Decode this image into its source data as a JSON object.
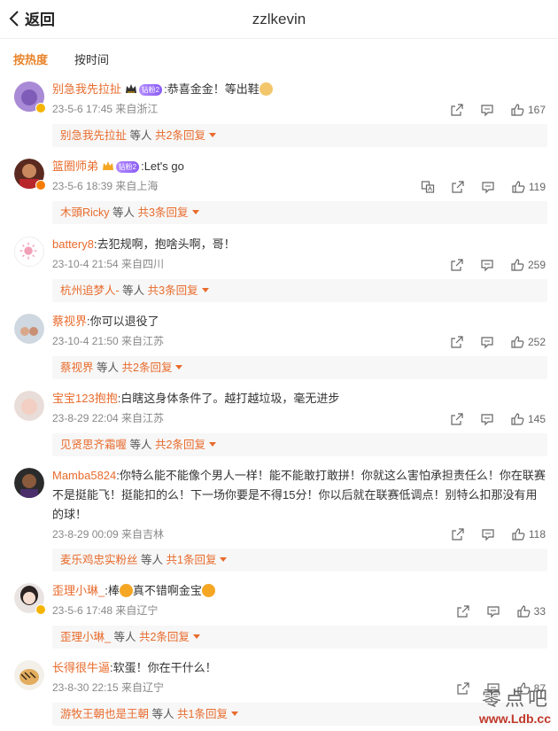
{
  "header": {
    "back_label": "返回",
    "title": "zzlkevin"
  },
  "sort": {
    "hot": "按热度",
    "time": "按时间"
  },
  "comments": [
    {
      "user": "别急我先拉扯",
      "medal": "钻粉2",
      "text": ":恭喜金金！等出鞋",
      "time": "23-5-6 17:45 来自浙江",
      "likes": "167",
      "reply_user": "别急我先拉扯",
      "reply_mid": "等人",
      "reply_count": "共2条回复"
    },
    {
      "user": "篮圈师弟",
      "medal": "钻粉2",
      "text": ":Let's go",
      "time": "23-5-6 18:39 来自上海",
      "likes": "119",
      "reply_user": "木頭Ricky",
      "reply_mid": "等人",
      "reply_count": "共3条回复"
    },
    {
      "user": "battery8",
      "text": ":去犯规啊，抱啥头啊，哥！",
      "time": "23-10-4 21:54 来自四川",
      "likes": "259",
      "reply_user": "杭州追梦人-",
      "reply_mid": "等人",
      "reply_count": "共3条回复"
    },
    {
      "user": "蔡视界",
      "text": ":你可以退役了",
      "time": "23-10-4 21:50 来自江苏",
      "likes": "252",
      "reply_user": "蔡视界",
      "reply_mid": "等人",
      "reply_count": "共2条回复"
    },
    {
      "user": "宝宝123抱抱",
      "text": ":白瞎这身体条件了。越打越垃圾，毫无进步",
      "time": "23-8-29 22:04 来自江苏",
      "likes": "145",
      "reply_user": "见贤思齐霜喔",
      "reply_mid": "等人",
      "reply_count": "共2条回复"
    },
    {
      "user": "Mamba5824",
      "text": ":你特么能不能像个男人一样！能不能敢打敢拼！你就这么害怕承担责任么！你在联赛不是挺能飞！挺能扣的么！下一场你要是不得15分！你以后就在联赛低调点！别特么扣那没有用的球！",
      "time": "23-8-29 00:09 来自吉林",
      "likes": "118",
      "reply_user": "麦乐鸡忠实粉丝",
      "reply_mid": "等人",
      "reply_count": "共1条回复"
    },
    {
      "user": "歪理小琳_",
      "text": ":棒",
      "text2": "真不错啊金宝",
      "time": "23-5-6 17:48 来自辽宁",
      "likes": "33",
      "reply_user": "歪理小琳_",
      "reply_mid": "等人",
      "reply_count": "共2条回复"
    },
    {
      "user": "长得很牛逼",
      "text": ":软蛋！你在干什么！",
      "time": "23-8-30 22:15 来自辽宁",
      "likes": "87",
      "reply_user": "游牧王朝也是王朝",
      "reply_mid": "等人",
      "reply_count": "共1条回复"
    }
  ],
  "watermark": {
    "text": "零点吧",
    "url": "www.Ldb.cc"
  },
  "colors": {
    "accent": "#e86b2c",
    "sort_active": "#e8832a",
    "reply_bg": "#f7f7f7"
  }
}
